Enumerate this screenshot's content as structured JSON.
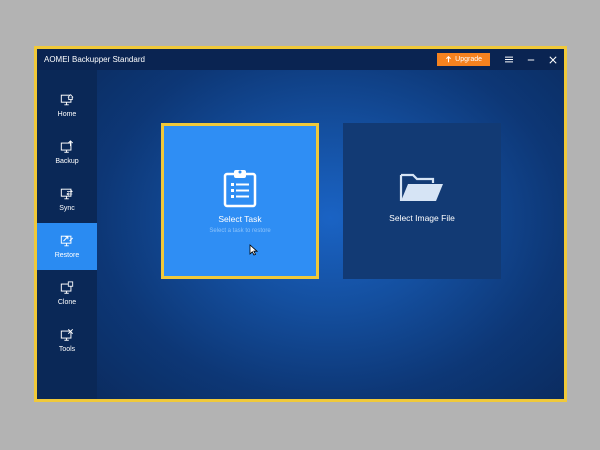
{
  "window": {
    "title": "AOMEI Backupper Standard",
    "upgrade_label": "Upgrade"
  },
  "sidebar": {
    "items": [
      {
        "label": "Home",
        "icon": "home-icon"
      },
      {
        "label": "Backup",
        "icon": "backup-icon"
      },
      {
        "label": "Sync",
        "icon": "sync-icon"
      },
      {
        "label": "Restore",
        "icon": "restore-icon",
        "active": true
      },
      {
        "label": "Clone",
        "icon": "clone-icon"
      },
      {
        "label": "Tools",
        "icon": "tools-icon"
      }
    ]
  },
  "main": {
    "select_task": {
      "title": "Select Task",
      "subtitle": "Select a task to restore",
      "icon": "clipboard-list-icon"
    },
    "select_image": {
      "title": "Select Image File",
      "icon": "folder-open-icon"
    }
  },
  "colors": {
    "accent": "#2a8bf2",
    "highlight_border": "#f0c93a",
    "upgrade": "#f5821f",
    "sidebar": "#0a2857"
  }
}
